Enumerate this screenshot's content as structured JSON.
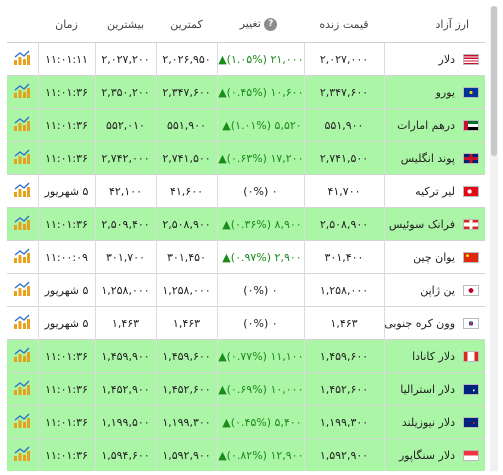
{
  "header": {
    "chart": "",
    "time": "زمان",
    "high": "بیشترین",
    "low": "کمترین",
    "change": "تغییر",
    "live": "قیمت زنده",
    "currency": "ارز آزاد",
    "help_icon": "?"
  },
  "colors": {
    "green_row": "#abf5a6",
    "up_text": "#1a8c1a"
  },
  "rows": [
    {
      "time": "۱۱:۰۱:۱۱",
      "high": "۲,۰۲۷,۲۰۰",
      "low": "۲,۰۲۶,۹۵۰",
      "change": "۲۱,۰۰۰ (۱.۰۵%)",
      "change_dir": "up",
      "live": "۲,۰۲۷,۰۰۰",
      "name": "دلار",
      "flag": "us-flag-icon",
      "bg": "white"
    },
    {
      "time": "۱۱:۰۱:۳۶",
      "high": "۲,۳۵۰,۲۰۰",
      "low": "۲,۳۴۷,۶۰۰",
      "change": "۱۰,۶۰۰ (۰.۴۵%)",
      "change_dir": "up",
      "live": "۲,۳۴۷,۶۰۰",
      "name": "یورو",
      "flag": "eu-flag-icon",
      "bg": "green"
    },
    {
      "time": "۱۱:۰۱:۳۶",
      "high": "۵۵۲,۰۱۰",
      "low": "۵۵۱,۹۰۰",
      "change": "۵,۵۲۰ (۱.۰۱%)",
      "change_dir": "up",
      "live": "۵۵۱,۹۰۰",
      "name": "درهم امارات",
      "flag": "ae-flag-icon",
      "bg": "green"
    },
    {
      "time": "۱۱:۰۱:۳۶",
      "high": "۲,۷۴۲,۰۰۰",
      "low": "۲,۷۴۱,۵۰۰",
      "change": "۱۷,۲۰۰ (۰.۶۳%)",
      "change_dir": "up",
      "live": "۲,۷۴۱,۵۰۰",
      "name": "پوند انگلیس",
      "flag": "gb-flag-icon",
      "bg": "green"
    },
    {
      "time": "۵ شهریور",
      "high": "۴۲,۱۰۰",
      "low": "۴۱,۶۰۰",
      "change": "۰ (۰%)",
      "change_dir": "none",
      "live": "۴۱,۷۰۰",
      "name": "لیر ترکیه",
      "flag": "tr-flag-icon",
      "bg": "white"
    },
    {
      "time": "۱۱:۰۱:۳۶",
      "high": "۲,۵۰۹,۴۰۰",
      "low": "۲,۵۰۸,۹۰۰",
      "change": "۸,۹۰۰ (۰.۳۶%)",
      "change_dir": "up",
      "live": "۲,۵۰۸,۹۰۰",
      "name": "فرانک سوئیس",
      "flag": "ch-flag-icon",
      "bg": "green"
    },
    {
      "time": "۱۱:۰۰:۰۹",
      "high": "۳۰۱,۷۰۰",
      "low": "۳۰۱,۴۵۰",
      "change": "۲,۹۰۰ (۰.۹۷%)",
      "change_dir": "up",
      "live": "۳۰۱,۴۰۰",
      "name": "یوان چین",
      "flag": "cn-flag-icon",
      "bg": "white"
    },
    {
      "time": "۵ شهریور",
      "high": "۱,۲۵۸,۰۰۰",
      "low": "۱,۲۵۸,۰۰۰",
      "change": "۰ (۰%)",
      "change_dir": "none",
      "live": "۱,۲۵۸,۰۰۰",
      "name": "ین ژاپن",
      "flag": "jp-flag-icon",
      "bg": "white"
    },
    {
      "time": "۵ شهریور",
      "high": "۱,۴۶۳",
      "low": "۱,۴۶۳",
      "change": "۰ (۰%)",
      "change_dir": "none",
      "live": "۱,۴۶۳",
      "name": "وون کره جنوبی",
      "flag": "kr-flag-icon",
      "bg": "white"
    },
    {
      "time": "۱۱:۰۱:۳۶",
      "high": "۱,۴۵۹,۹۰۰",
      "low": "۱,۴۵۹,۶۰۰",
      "change": "۱۱,۱۰۰ (۰.۷۷%)",
      "change_dir": "up",
      "live": "۱,۴۵۹,۶۰۰",
      "name": "دلار کانادا",
      "flag": "ca-flag-icon",
      "bg": "green"
    },
    {
      "time": "۱۱:۰۱:۳۶",
      "high": "۱,۴۵۲,۹۰۰",
      "low": "۱,۴۵۲,۶۰۰",
      "change": "۱۰,۰۰۰ (۰.۶۹%)",
      "change_dir": "up",
      "live": "۱,۴۵۲,۶۰۰",
      "name": "دلار استرالیا",
      "flag": "au-flag-icon",
      "bg": "green"
    },
    {
      "time": "۱۱:۰۱:۳۶",
      "high": "۱,۱۹۹,۵۰۰",
      "low": "۱,۱۹۹,۳۰۰",
      "change": "۵,۴۰۰ (۰.۴۵%)",
      "change_dir": "up",
      "live": "۱,۱۹۹,۳۰۰",
      "name": "دلار نیوزیلند",
      "flag": "nz-flag-icon",
      "bg": "green"
    },
    {
      "time": "۱۱:۰۱:۳۶",
      "high": "۱,۵۹۴,۶۰۰",
      "low": "۱,۵۹۲,۹۰۰",
      "change": "۱۲,۹۰۰ (۰.۸۲%)",
      "change_dir": "up",
      "live": "۱,۵۹۲,۹۰۰",
      "name": "دلار سنگاپور",
      "flag": "sg-flag-icon",
      "bg": "green"
    }
  ]
}
